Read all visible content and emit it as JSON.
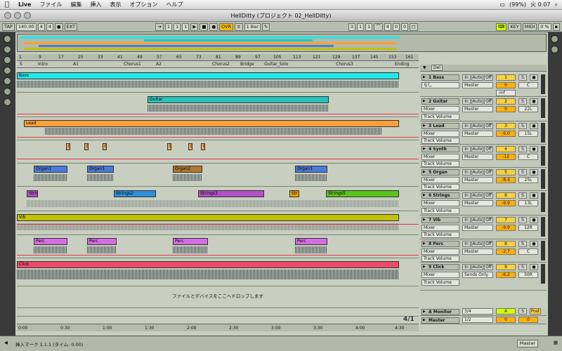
{
  "menubar": {
    "items": [
      "Live",
      "ファイル",
      "編集",
      "挿入",
      "表示",
      "オプション",
      "ヘルプ"
    ],
    "battery": "(99%)",
    "clock": "火 0:07"
  },
  "window": {
    "title": "HellDitty (プロジェクト 02_HellDitty)"
  },
  "transport": {
    "tap": "TAP",
    "tempo": "140.00",
    "sig_num": "4",
    "sig_den": "4",
    "dot": "●",
    "ext": "EXT",
    "pos_bar": "1",
    "pos_beat": "1",
    "pos_sixteenth": "1",
    "ovr": "OVR",
    "quant": "1 Bar",
    "loop_bar": "3",
    "loop_beat": "1",
    "loop_sixteenth": "1",
    "loop_len_bar": "4",
    "loop_len_beat": "0",
    "loop_len_sixteenth": "0",
    "key": "KEY",
    "midi": "MIDI",
    "cpu": "0 %"
  },
  "ruler": {
    "bars": [
      "1",
      "9",
      "17",
      "25",
      "33",
      "41",
      "49",
      "57",
      "65",
      "73",
      "81",
      "89",
      "97",
      "105",
      "113",
      "121",
      "129",
      "137",
      "145",
      "153",
      "161"
    ]
  },
  "locators": [
    "S",
    "Intro",
    "A1",
    "Chorus1",
    "A2",
    "Chorus2",
    "Bridge",
    "Guitar_Solo",
    "Chorus3",
    "Ending"
  ],
  "tracks": [
    {
      "label": "Bass",
      "clips": [
        "Bass"
      ]
    },
    {
      "label": "Guitar",
      "clips": [
        "Guitar"
      ]
    },
    {
      "label": "Lead",
      "clips": [
        "Lead"
      ]
    },
    {
      "label": "Synth",
      "clips": [
        "C",
        "C",
        "C",
        "C",
        "C",
        "C"
      ]
    },
    {
      "label": "Organ",
      "clips": [
        "Organ1",
        "Organ1",
        "Organ2",
        "Organ1"
      ]
    },
    {
      "label": "Strings",
      "clips": [
        "Strin",
        "Strings2",
        "Strings3",
        "Str",
        "Strings5"
      ]
    },
    {
      "label": "Vib",
      "clips": [
        "Vib"
      ]
    },
    {
      "label": "Perc",
      "clips": [
        "Perc",
        "Perc",
        "Perc",
        "Perc"
      ]
    },
    {
      "label": "Click",
      "clips": [
        "Click"
      ]
    }
  ],
  "drop_hint": "ファイルとデバイスをここへドロップします",
  "time_ruler": [
    "0:00",
    "0:30",
    "1:00",
    "1:30",
    "2:00",
    "2:30",
    "3:00",
    "3:30",
    "4:00",
    "4:30"
  ],
  "page_indicator": "4/1",
  "mixer": {
    "header_label": "Del",
    "rows": [
      {
        "name": "1 Bass",
        "input": "なし",
        "output": "Master",
        "num": "1",
        "vol": "0",
        "pan": "C",
        "extra": "-inf",
        "mode_in": "In",
        "mode_auto": "Auto",
        "mode_off": "Off",
        "solo": "S"
      },
      {
        "name": "2 Guitar",
        "input": "Mixer",
        "output": "Master",
        "num": "2",
        "vol": "0",
        "pan": "22L",
        "extra": "Track Volume",
        "mode_in": "In",
        "mode_auto": "Auto",
        "mode_off": "Off",
        "solo": "S"
      },
      {
        "name": "3 Lead",
        "input": "Mixer",
        "output": "Master",
        "num": "3",
        "vol": "-6.0",
        "pan": "15L",
        "extra": "Track Volume",
        "mode_in": "In",
        "mode_auto": "Auto",
        "mode_off": "Off",
        "solo": "S"
      },
      {
        "name": "4 Synth",
        "input": "Mixer",
        "output": "Master",
        "num": "4",
        "vol": "-12",
        "pan": "C",
        "extra": "Track Volume",
        "mode_in": "In",
        "mode_auto": "Auto",
        "mode_off": "Off",
        "solo": "S"
      },
      {
        "name": "5 Organ",
        "input": "Mixer",
        "output": "Master",
        "num": "5",
        "vol": "-8.4",
        "pan": "25L",
        "extra": "Track Volume",
        "mode_in": "In",
        "mode_auto": "Auto",
        "mode_off": "Off",
        "solo": "S"
      },
      {
        "name": "6 Strings",
        "input": "Mixer",
        "output": "Master",
        "num": "6",
        "vol": "-9.9",
        "pan": "13L",
        "extra": "Track Volume",
        "mode_in": "In",
        "mode_auto": "Auto",
        "mode_off": "Off",
        "solo": "S"
      },
      {
        "name": "7 Vib",
        "input": "Mixer",
        "output": "Master",
        "num": "7",
        "vol": "-9.9",
        "pan": "12R",
        "extra": "Track Volume",
        "mode_in": "In",
        "mode_auto": "Auto",
        "mode_off": "Off",
        "solo": "S"
      },
      {
        "name": "8 Perc",
        "input": "Mixer",
        "output": "Master",
        "num": "8",
        "vol": "-2.7",
        "pan": "C",
        "extra": "Track Volume",
        "mode_in": "In",
        "mode_auto": "Auto",
        "mode_off": "Off",
        "solo": "S"
      },
      {
        "name": "9 Click",
        "input": "Mixer",
        "output": "Sends Only",
        "num": "9",
        "vol": "-6.2",
        "pan": "50R",
        "extra": "Track Volume",
        "mode_in": "In",
        "mode_auto": "Auto",
        "mode_off": "Off",
        "solo": "S"
      }
    ],
    "monitor": {
      "name": "A Monitor",
      "sig": "3/4",
      "btn": "A",
      "solo": "S",
      "post": "Post"
    },
    "master": {
      "name": "Master",
      "sig": "1/2",
      "vol": "0",
      "pan": "0"
    }
  },
  "status": {
    "text": "挿入マーク 1.1.1 (タイム: 0:00)",
    "master": "Master"
  },
  "colors": {
    "bass": "#1fe8e8",
    "guitar": "#27c3b9",
    "lead": "#ff9f3a",
    "synth": "#f2a24a",
    "organ": "#4c7ad6",
    "organ2": "#b07a2d",
    "strings": "#b34fc7",
    "strings2": "#2f8fd8",
    "strings5": "#58c51a",
    "str": "#e8a000",
    "vib": "#c0c200",
    "perc": "#d46de0",
    "click": "#ef4a6a",
    "automation": "#e5364a"
  }
}
